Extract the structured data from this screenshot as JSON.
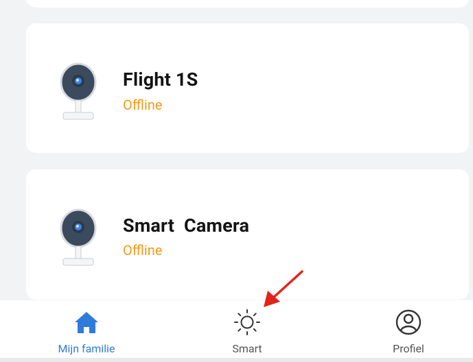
{
  "devices": [
    {
      "name": "Flight 1S",
      "status": "Offline"
    },
    {
      "name": "Smart  Camera",
      "status": "Offline"
    }
  ],
  "nav": {
    "home_label": "Mijn familie",
    "smart_label": "Smart",
    "profile_label": "Profiel"
  },
  "colors": {
    "accent": "#2f7bd9",
    "status_offline": "#f39a1a",
    "annotation_arrow": "#e2231a"
  },
  "icons": {
    "home": "home-icon",
    "smart": "sun-icon",
    "profile": "user-circle-icon",
    "device": "camera-icon"
  }
}
